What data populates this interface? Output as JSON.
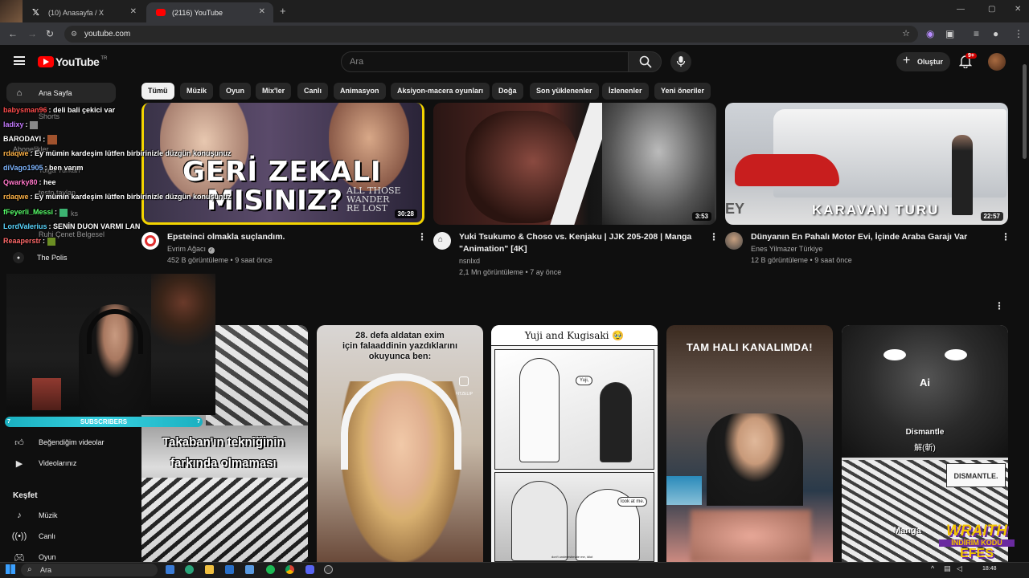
{
  "browser": {
    "tabs": [
      {
        "title": "(10) Anasayfa / X"
      },
      {
        "title": "(2116) YouTube"
      }
    ],
    "url": "youtube.com"
  },
  "youtube": {
    "logo": "YouTube",
    "logo_region": "TR",
    "search_placeholder": "Ara",
    "create_label": "Oluştur",
    "notif_badge": "9+",
    "chips": [
      "Tümü",
      "Müzik",
      "Oyun",
      "Mix'ler",
      "Canlı",
      "Animasyon",
      "Aksiyon-macera oyunları",
      "Doğa",
      "Son yüklenenler",
      "İzlenenler",
      "Yeni öneriler"
    ]
  },
  "sidebar": {
    "home": "Ana Sayfa",
    "shorts": "Shorts",
    "subscriptions": "Abonelikler",
    "sub_items": [
      "Tolga Turkan",
      "testo taylan",
      "Ferit wtcN",
      "Ruhi Çenet Belgesel",
      "The Polis"
    ],
    "channel_tag": "ks",
    "liked": "Beğendiğim videolar",
    "your_videos": "Videolarınız",
    "explore": "Keşfet",
    "music": "Müzik",
    "live": "Canlı",
    "gaming": "Oyun"
  },
  "videos": [
    {
      "title": "Epsteinci olmakla suçlandım.",
      "channel": "Evrim Ağacı",
      "meta": "452 B görüntüleme • 9 saat önce",
      "duration": "30:28",
      "thumb_text_1": "GERİ ZEKALI",
      "thumb_text_2": "MISINIZ?",
      "thumb_text_3": "ALL THOSE",
      "thumb_text_4": "WANDER",
      "thumb_text_5": "RE LOST"
    },
    {
      "title_1": "Yuki Tsukumo & Choso vs. Kenjaku | JJK 205-208 | Manga",
      "title_2": "\"Animation\" [4K]",
      "channel": "nsnlxd",
      "meta": "2,1 Mn görüntüleme • 7 ay önce",
      "duration": "3:53"
    },
    {
      "title": "Dünyanın En Pahalı Motor Evi, İçinde Araba Garajı Var",
      "channel": "Enes Yilmazer Türkiye",
      "meta": "12 B görüntüleme • 9 saat önce",
      "duration": "22:57",
      "thumb_text": "KARAVAN TURU",
      "thumb_side": "EY"
    }
  ],
  "shorts": [
    {
      "text_1": "Takaban'ın tekniğinin",
      "text_2": "farkında olmaması"
    },
    {
      "text_1": "28. defa aldatan exim",
      "text_2": "için falaaddinin yazdıklarını",
      "text_3": "okuyunca ben:",
      "handle": "@MAFITZELIP"
    },
    {
      "text_1": "Yuji and Kugisaki 🥹",
      "bubble_1": "Yuji,",
      "bubble_2": "look at me.",
      "bubble_3": "don't underestimate me, idiot"
    },
    {
      "text_1": "TAM HALI KANALIMDA!"
    },
    {
      "text_1": "Ai",
      "text_2": "Dismantle",
      "text_3": "解(斬)",
      "text_4": "DISMANTLE.",
      "text_5": "Manga"
    }
  ],
  "stream": {
    "subscribers_label": "SUBSCRIBERS",
    "sub_left": "7",
    "sub_right": "7",
    "chat": [
      {
        "user": "babysman96",
        "msg": ": deli bali çekici var",
        "color": "#ff4d4d"
      },
      {
        "user": "ladixy",
        "msg": ":",
        "color": "#c57bff"
      },
      {
        "user": "BARODAYI",
        "msg": ":",
        "color": "#ffffff"
      },
      {
        "user": "rdaqwe",
        "msg": ": Ey mümin kardeşim lütfen birbirinizle düzgün konuşunuz",
        "color": "#ffb347"
      },
      {
        "user": "diVago1905",
        "msg": ": ben varım",
        "color": "#7fb6ff"
      },
      {
        "user": "Qwarky80",
        "msg": ": hee",
        "color": "#ff77c8"
      },
      {
        "user": "rdaqwe",
        "msg": ": Ey mümin kardeşim lütfen birbirinizle düzgün konuşunuz",
        "color": "#ffb347"
      },
      {
        "user": "fFeyerli_Messi",
        "msg": ":",
        "color": "#58ff6a"
      },
      {
        "user": "LordValerius",
        "msg": ": SENİN DUON VARMI LAN",
        "color": "#5ad7ff"
      },
      {
        "user": "Reaaperstr",
        "msg": ":",
        "color": "#ff6a6a"
      }
    ],
    "brand_1": "WRAITH",
    "brand_2": "İNDİRİM KODU",
    "brand_3": "EFES"
  },
  "taskbar": {
    "search": "Ara",
    "time": "18:48"
  }
}
